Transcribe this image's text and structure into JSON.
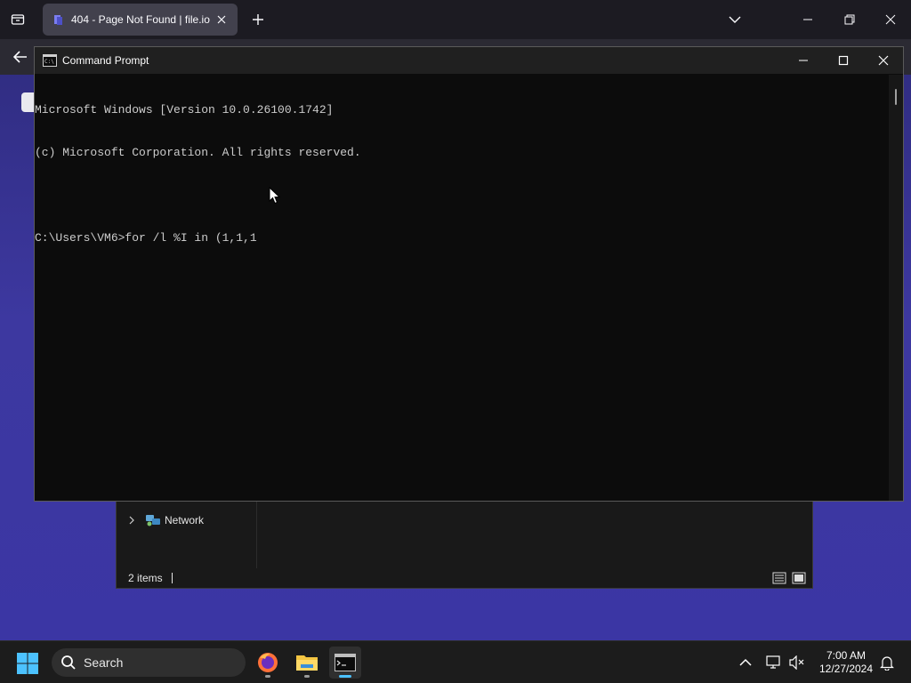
{
  "browser": {
    "tab_title": "404 - Page Not Found | file.io",
    "colors": {
      "tabbar": "#1c1b22",
      "tab_active": "#42414d",
      "toolbar": "#2b2a33"
    }
  },
  "explorer": {
    "nav_item_label": "Network",
    "status_text": "2 items"
  },
  "cmd": {
    "title": "Command Prompt",
    "lines": [
      "Microsoft Windows [Version 10.0.26100.1742]",
      "(c) Microsoft Corporation. All rights reserved.",
      "",
      "C:\\Users\\VM6>for /l %I in (1,1,1"
    ],
    "colors": {
      "background": "#0c0c0c",
      "text": "#cccccc",
      "titlebar": "#202020"
    }
  },
  "taskbar": {
    "search_label": "Search",
    "time": "7:00 AM",
    "date": "12/27/2024",
    "apps": [
      "firefox-icon",
      "file-explorer-icon",
      "terminal-icon"
    ],
    "colors": {
      "background": "#1c1c1c",
      "accent": "#4cc2ff"
    }
  }
}
